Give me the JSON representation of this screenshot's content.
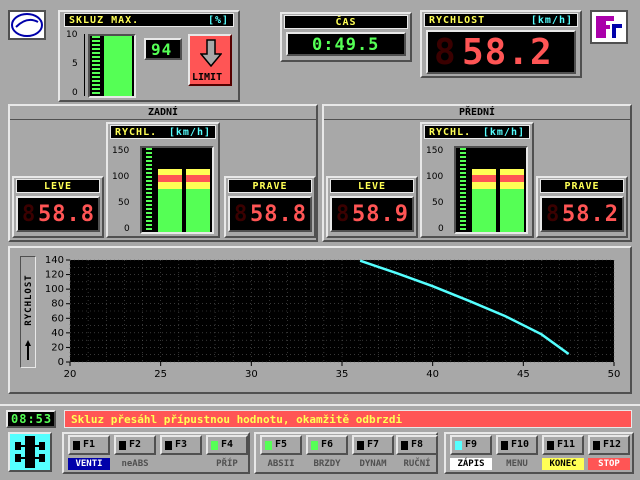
{
  "slip": {
    "title": "SKLUZ MAX.",
    "unit": "[%]",
    "scale": [
      "10",
      "5",
      "0"
    ],
    "value_display": "94",
    "level_fraction": 1.0,
    "limit_label": "LIMIT"
  },
  "time": {
    "title": "ČAS",
    "display": "0:49.5"
  },
  "speed": {
    "title": "RYCHLOST",
    "unit": "[km/h]",
    "display": "58.2"
  },
  "rear": {
    "title": "ZADNÍ",
    "speed_title": "RYCHL.",
    "speed_unit": "[km/h]",
    "scale": [
      "150",
      "100",
      "50",
      "0"
    ],
    "left_label": "LEVE",
    "left_display": "58.8",
    "right_label": "PRAVE",
    "right_display": "58.8",
    "left_bar_kmh": 113,
    "right_bar_kmh": 113
  },
  "front": {
    "title": "PŘEDNÍ",
    "speed_title": "RYCHL.",
    "speed_unit": "[km/h]",
    "scale": [
      "150",
      "100",
      "50",
      "0"
    ],
    "left_label": "LEVE",
    "left_display": "58.9",
    "right_label": "PRAVE",
    "right_display": "58.2",
    "left_bar_kmh": 113,
    "right_bar_kmh": 113
  },
  "chart_data": {
    "type": "line",
    "title": "",
    "xlabel": "",
    "ylabel": "RYCHLOST",
    "xlim": [
      20,
      50
    ],
    "ylim": [
      0,
      140
    ],
    "x_ticks": [
      "20",
      "25",
      "30",
      "35",
      "40",
      "45",
      "50"
    ],
    "y_ticks": [
      "140",
      "120",
      "100",
      "80",
      "60",
      "40",
      "20",
      "0"
    ],
    "grid": true,
    "series": [
      {
        "color": "#55ffff",
        "x": [
          36.0,
          38.0,
          40.0,
          42.0,
          44.0,
          46.0,
          47.5
        ],
        "y": [
          139,
          122,
          104,
          84,
          63,
          38,
          11
        ]
      }
    ]
  },
  "status": {
    "clock": "08:53",
    "message": "Skluz přesáhl přípustnou hodnotu, okamžitě odbrzdi"
  },
  "fkeys": [
    {
      "key": "F1",
      "label": "VENTI",
      "led": "off",
      "label_style": "active-blue"
    },
    {
      "key": "F2",
      "label": "neABS",
      "led": "off",
      "label_style": "dim"
    },
    {
      "key": "F3",
      "label": "",
      "led": "off",
      "label_style": "dim"
    },
    {
      "key": "F4",
      "label": "PŘÍP",
      "led": "on",
      "label_style": "dim"
    },
    {
      "key": "F5",
      "label": "ABSII",
      "led": "on",
      "label_style": "dim"
    },
    {
      "key": "F6",
      "label": "BRZDY",
      "led": "on",
      "label_style": "dim"
    },
    {
      "key": "F7",
      "label": "DYNAM",
      "led": "off",
      "label_style": "dim"
    },
    {
      "key": "F8",
      "label": "RUČNÍ",
      "led": "off",
      "label_style": "dim"
    },
    {
      "key": "F9",
      "label": "ZÁPIS",
      "led": "cyan",
      "label_style": "active-white"
    },
    {
      "key": "F10",
      "label": "MENU",
      "led": "off",
      "label_style": "dim"
    },
    {
      "key": "F11",
      "label": "KONEC",
      "led": "off",
      "label_style": "active-yellow"
    },
    {
      "key": "F12",
      "label": "STOP",
      "led": "off",
      "label_style": "active-red"
    }
  ],
  "colors": {
    "panel": "#a8a8a8",
    "lcd_red": "#ff5555",
    "lcd_green": "#55ff55",
    "accent_yellow": "#ffff55",
    "accent_cyan": "#55ffff",
    "alert": "#ff5555"
  }
}
